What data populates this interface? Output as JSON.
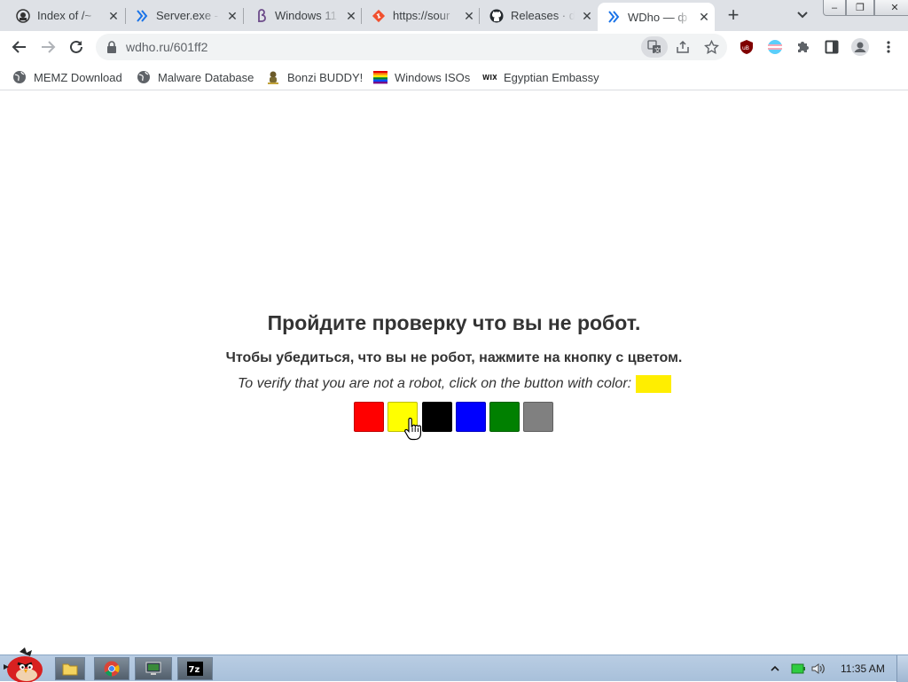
{
  "tabs": [
    {
      "title": "Index of /~",
      "icon": "github-mark-icon",
      "active": false
    },
    {
      "title": "Server.exe - ",
      "icon": "chevron-double-icon",
      "active": false
    },
    {
      "title": "Windows 11",
      "icon": "beta-icon",
      "active": false
    },
    {
      "title": "https://sour",
      "icon": "git-diamond-icon",
      "active": false
    },
    {
      "title": "Releases · d",
      "icon": "github-icon",
      "active": false
    },
    {
      "title": "WDho — ф",
      "icon": "chevron-double-icon",
      "active": true
    }
  ],
  "window_controls": {
    "minimize": "–",
    "maximize": "❐",
    "close": "✕"
  },
  "omnibox": {
    "url": "wdho.ru/601ff2"
  },
  "bookmarks": [
    {
      "label": "MEMZ Download",
      "icon": "globe-icon"
    },
    {
      "label": "Malware Database",
      "icon": "globe-icon"
    },
    {
      "label": "Bonzi BUDDY!",
      "icon": "bonzi-icon"
    },
    {
      "label": "Windows ISOs",
      "icon": "rainbow-flag-icon"
    },
    {
      "label": "Egyptian Embassy",
      "icon": "wix-icon"
    }
  ],
  "page": {
    "title": "Пройдите проверку что вы не робот.",
    "subtitle": "Чтобы убедиться, что вы не робот, нажмите на кнопку с цветом.",
    "verify_text": "To verify that you are not a robot, click on the button with color:",
    "target_color": "#ffee00",
    "color_buttons": [
      {
        "name": "red",
        "color": "#ff0000"
      },
      {
        "name": "yellow",
        "color": "#ffff00"
      },
      {
        "name": "black",
        "color": "#000000"
      },
      {
        "name": "blue",
        "color": "#0000ff"
      },
      {
        "name": "green",
        "color": "#008000"
      },
      {
        "name": "gray",
        "color": "#808080"
      }
    ]
  },
  "taskbar": {
    "clock": "11:35 AM",
    "items": [
      "file-explorer-icon",
      "chrome-icon",
      "remote-desktop-icon",
      "7zip-icon"
    ]
  }
}
